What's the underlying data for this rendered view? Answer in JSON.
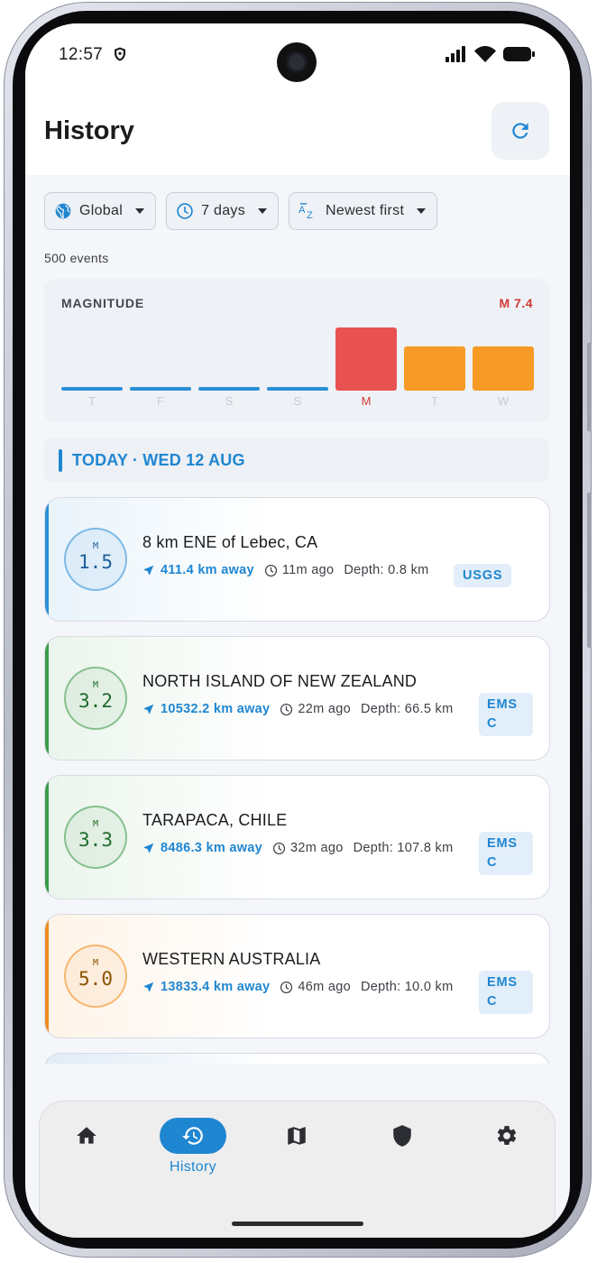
{
  "status_bar": {
    "time": "12:57"
  },
  "header": {
    "title": "History"
  },
  "filters": [
    {
      "label": "Global",
      "icon": "globe-icon"
    },
    {
      "label": "7 days",
      "icon": "clock-icon"
    },
    {
      "label": "Newest first",
      "icon": "sort-az-icon"
    }
  ],
  "event_count": "500 events",
  "magnitude_chart": {
    "title": "MAGNITUDE",
    "max_label": "M 7.4",
    "colors": {
      "red": "#e85352",
      "orange": "#f69b26",
      "blue": "#2c8fd6"
    },
    "chart_data": {
      "type": "bar",
      "categories": [
        "T",
        "F",
        "S",
        "S",
        "M",
        "T",
        "W"
      ],
      "values": [
        0,
        0,
        0,
        0,
        7.4,
        5.2,
        5.2
      ],
      "highlight_index": 4
    }
  },
  "section": {
    "label": "TODAY · WED 12 AUG"
  },
  "events": [
    {
      "mag_prefix": "M",
      "magnitude": "1.5",
      "place": "8 km ENE of Lebec, CA",
      "distance": "411.4 km away",
      "ago": "11m ago",
      "depth": "Depth: 0.8 km",
      "source": "USGS",
      "source_lines": [
        "USGS"
      ],
      "color": "#2c8fd6"
    },
    {
      "mag_prefix": "M",
      "magnitude": "3.2",
      "place": "NORTH ISLAND OF NEW ZEALAND",
      "distance": "10532.2 km away",
      "ago": "22m ago",
      "depth": "Depth: 66.5 km",
      "source": "EMSC",
      "source_lines": [
        "EMS",
        "C"
      ],
      "color": "#3a9a47"
    },
    {
      "mag_prefix": "M",
      "magnitude": "3.3",
      "place": "TARAPACA, CHILE",
      "distance": "8486.3 km away",
      "ago": "32m ago",
      "depth": "Depth: 107.8 km",
      "source": "EMSC",
      "source_lines": [
        "EMS",
        "C"
      ],
      "color": "#3a9a47"
    },
    {
      "mag_prefix": "M",
      "magnitude": "5.0",
      "place": "WESTERN AUSTRALIA",
      "distance": "13833.4 km away",
      "ago": "46m ago",
      "depth": "Depth: 10.0 km",
      "source": "EMSC",
      "source_lines": [
        "EMS",
        "C"
      ],
      "color": "#f08c1e"
    }
  ],
  "nav": [
    {
      "icon": "home-icon",
      "label": ""
    },
    {
      "icon": "history-icon",
      "label": "History",
      "active": true
    },
    {
      "icon": "map-icon",
      "label": ""
    },
    {
      "icon": "shield-icon",
      "label": ""
    },
    {
      "icon": "settings-icon",
      "label": ""
    }
  ]
}
